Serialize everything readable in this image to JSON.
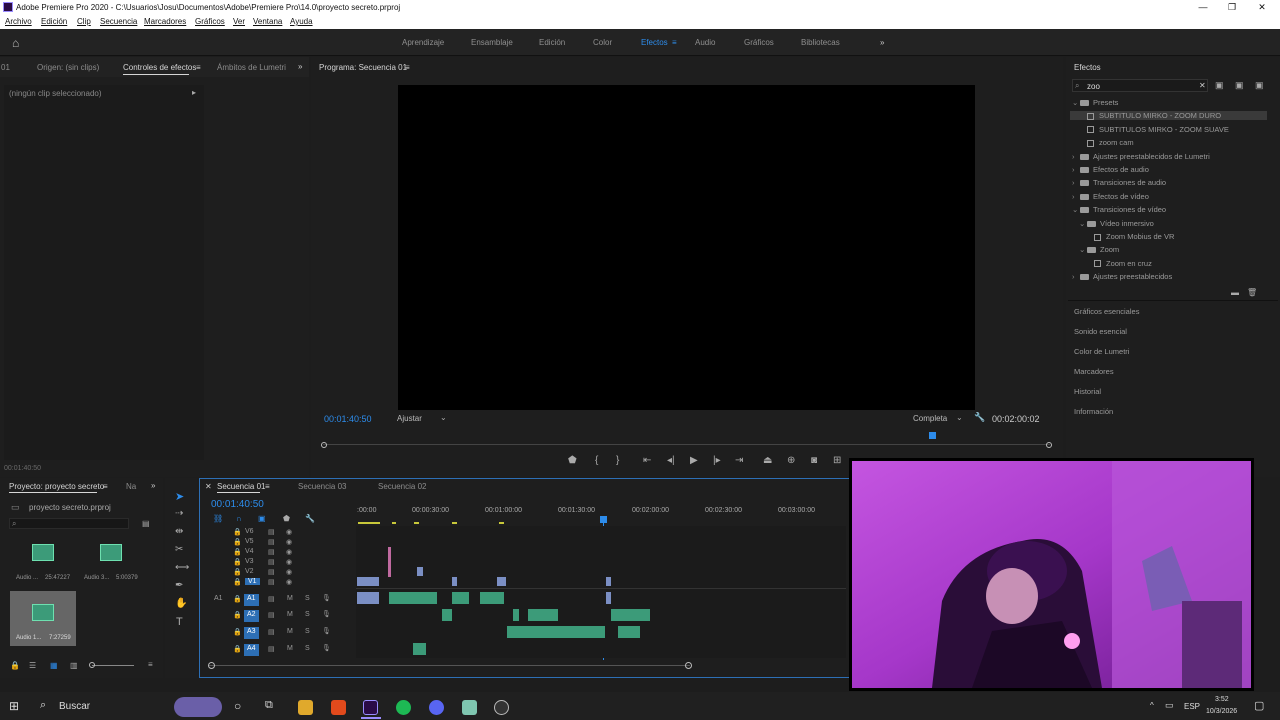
{
  "window": {
    "title": "Adobe Premiere Pro 2020 - C:\\Usuarios\\Josu\\Documentos\\Adobe\\Premiere Pro\\14.0\\proyecto secreto.prproj"
  },
  "menu": [
    "Archivo",
    "Edición",
    "Clip",
    "Secuencia",
    "Marcadores",
    "Gráficos",
    "Ver",
    "Ventana",
    "Ayuda"
  ],
  "workspaces": [
    "Aprendizaje",
    "Ensamblaje",
    "Edición",
    "Color",
    "Efectos",
    "Audio",
    "Gráficos",
    "Bibliotecas"
  ],
  "active_workspace": "Efectos",
  "source_panel": {
    "tab_prefix": "01",
    "tabs": [
      "Origen: (sin clips)",
      "Controles de efectos",
      "Ámbitos de Lumetri"
    ],
    "active_tab": "Controles de efectos",
    "empty_text": "(ningún clip seleccionado)",
    "timecode": "00:01:40:50"
  },
  "program": {
    "tab": "Programa: Secuencia 01",
    "timecode": "00:01:40:50",
    "fit": "Ajustar",
    "quality": "Completa",
    "duration": "00:02:00:02"
  },
  "effects": {
    "tab": "Efectos",
    "search_value": "zoo",
    "tree": [
      {
        "label": "Presets",
        "kind": "folder",
        "open": true,
        "level": 0
      },
      {
        "label": "SUBTITULO MIRKO - ZOOM DURO",
        "kind": "preset",
        "level": 1,
        "selected": true
      },
      {
        "label": "SUBTITULOS MIRKO - ZOOM SUAVE",
        "kind": "preset",
        "level": 1
      },
      {
        "label": "zoom cam",
        "kind": "preset",
        "level": 1
      },
      {
        "label": "Ajustes preestablecidos de Lumetri",
        "kind": "folder",
        "level": 0
      },
      {
        "label": "Efectos de audio",
        "kind": "folder",
        "level": 0
      },
      {
        "label": "Transiciones de audio",
        "kind": "folder",
        "level": 0
      },
      {
        "label": "Efectos de vídeo",
        "kind": "folder",
        "level": 0
      },
      {
        "label": "Transiciones de vídeo",
        "kind": "folder",
        "open": true,
        "level": 0
      },
      {
        "label": "Vídeo inmersivo",
        "kind": "folder",
        "open": true,
        "level": 1
      },
      {
        "label": "Zoom Mobius de VR",
        "kind": "preset",
        "level": 2
      },
      {
        "label": "Zoom",
        "kind": "folder",
        "open": true,
        "level": 1
      },
      {
        "label": "Zoom en cruz",
        "kind": "preset",
        "level": 2
      },
      {
        "label": "Ajustes preestablecidos",
        "kind": "folder",
        "level": 0
      }
    ],
    "sections": [
      "Gráficos esenciales",
      "Sonido esencial",
      "Color de Lumetri",
      "Marcadores",
      "Historial",
      "Información"
    ]
  },
  "project": {
    "tabs": [
      "Proyecto: proyecto secreto",
      "Na"
    ],
    "file": "proyecto secreto.prproj",
    "items": [
      {
        "name": "Audio ...",
        "duration": "25:47227"
      },
      {
        "name": "Audio 3...",
        "duration": "5:00379"
      },
      {
        "name": "Audio 1...",
        "duration": "7:27259"
      }
    ]
  },
  "timeline": {
    "tabs": [
      "Secuencia 01",
      "Secuencia 03",
      "Secuencia 02"
    ],
    "active_tab": "Secuencia 01",
    "timecode": "00:01:40:50",
    "ruler": [
      ":00:00",
      "00:00:30:00",
      "00:01:00:00",
      "00:01:30:00",
      "00:02:00:00",
      "00:02:30:00",
      "00:03:00:00"
    ],
    "video_tracks": [
      "V6",
      "V5",
      "V4",
      "V3",
      "V2",
      "V1"
    ],
    "audio_tracks": [
      "A1",
      "A2",
      "A3",
      "A4"
    ],
    "source_patch": "A1",
    "mute": "M",
    "solo": "S"
  },
  "taskbar": {
    "search": "Buscar",
    "lang": "ESP",
    "time": "3:52",
    "date": "10/3/2026"
  },
  "colors": {
    "accent": "#2d8ceb",
    "audio_clip": "#3c9b79",
    "video_clip": "#7b8fc4",
    "webcam_tint": "#b03bd6"
  }
}
